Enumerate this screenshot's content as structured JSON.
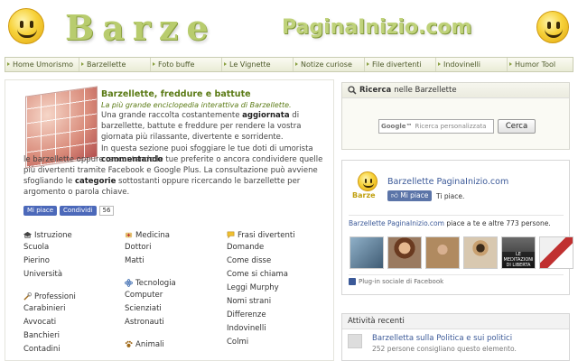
{
  "header": {
    "logo_left": "Barze",
    "logo_right": "PaginaInizio.com"
  },
  "nav": [
    "Home Umorismo",
    "Barzellette",
    "Foto buffe",
    "Le Vignette",
    "Notize curiose",
    "File divertenti",
    "Indovinelli",
    "Humor Tool"
  ],
  "intro": {
    "title": "Barzellette, freddure e battute",
    "subtitle": "La più grande enciclopedia interattiva di Barzellette.",
    "p1_a": "Una grande raccolta costantemente ",
    "p1_b": "aggiornata",
    "p1_c": " di barzellette, battute e freddure per rendere la vostra giornata più rilassante, divertente e sorridente.",
    "p2_a": "In questa sezione puoi sfoggiare le tue doti di umorista ",
    "p2_b": "commentando",
    "p2_c": " le barzellette oppure raccontando le tue preferite o ancora condividere quelle più divertenti tramite Facebook e Google Plus.",
    "p3_a": "La consultazione può avviene sfogliando le ",
    "p3_b": "categorie",
    "p3_c": " sottostanti oppure ricercando le barzellette per argomento o parola chiave."
  },
  "social": {
    "like": "Mi piace",
    "share": "Condividi",
    "count": "56"
  },
  "categories": {
    "istruzione": {
      "title": "Istruzione",
      "items": [
        "Scuola",
        "Pierino",
        "Università"
      ]
    },
    "professioni": {
      "title": "Professioni",
      "items": [
        "Carabinieri",
        "Avvocati",
        "Banchieri",
        "Contadini"
      ]
    },
    "medicina": {
      "title": "Medicina",
      "items": [
        "Dottori",
        "Matti"
      ]
    },
    "tecnologia": {
      "title": "Tecnologia",
      "items": [
        "Computer",
        "Scienziati",
        "Astronauti"
      ]
    },
    "animali": {
      "title": "Animali"
    },
    "frasi": {
      "title": "Frasi divertenti",
      "items": [
        "Domande",
        "Come disse",
        "Come si chiama",
        "Leggi Murphy",
        "Nomi strani",
        "Differenze",
        "Indovinelli",
        "Colmi"
      ]
    }
  },
  "search": {
    "title_bold": "Ricerca",
    "title_rest": " nelle Barzellette",
    "google": "Google™",
    "placeholder": "Ricerca personalizzata",
    "button": "Cerca"
  },
  "facebook": {
    "logo_text": "Barze",
    "page_name": "Barzellette PaginaInizio.com",
    "like": "Mi piace",
    "like_text": "Ti piace.",
    "fans_link": "Barzellette PaginaInizio.com",
    "fans_text": " piace a te e altre 773 persone.",
    "face_caption": "LE MEDITAZIONI DI LIBERTA",
    "plugin": "Plug-in sociale di Facebook"
  },
  "activity": {
    "title": "Attività recenti",
    "item_title": "Barzelletta sulla Politica e sui politici",
    "item_sub": "252 persone consigliano questo elemento."
  },
  "colors": {
    "accent": "#5a7a14",
    "facebook": "#3b5998",
    "logo": "#bfd27a"
  }
}
